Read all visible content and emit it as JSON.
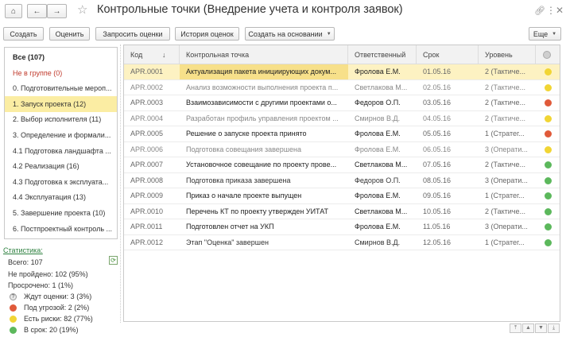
{
  "window": {
    "title": "Контрольные точки (Внедрение учета и контроля заявок)",
    "home_icon": "home-icon",
    "back_icon": "arrow-left-icon",
    "forward_icon": "arrow-right-icon",
    "star_icon": "star-icon",
    "link_icon": "link-icon",
    "menu_icon": "more-vertical-icon",
    "close_icon": "close-icon"
  },
  "toolbar": {
    "create": "Создать",
    "evaluate": "Оценить",
    "request": "Запросить оценки",
    "history": "История оценок",
    "based_on": "Создать на основании",
    "more": "Еще"
  },
  "groups": [
    {
      "label": "Все (107)",
      "style": "bold"
    },
    {
      "label": "Не в группе (0)",
      "style": "red"
    },
    {
      "label": "0. Подготовительные мероп...",
      "style": ""
    },
    {
      "label": "1. Запуск проекта (12)",
      "style": "selected"
    },
    {
      "label": "2. Выбор исполнителя (11)",
      "style": ""
    },
    {
      "label": "3. Определение и формали...",
      "style": ""
    },
    {
      "label": "4.1 Подготовка ландшафта ...",
      "style": ""
    },
    {
      "label": "4.2 Реализация (16)",
      "style": ""
    },
    {
      "label": "4.3 Подготовка к эксплуата...",
      "style": ""
    },
    {
      "label": "4.4 Эксплуатация (13)",
      "style": ""
    },
    {
      "label": "5. Завершение проекта (10)",
      "style": ""
    },
    {
      "label": "6. Постпроектный контроль ...",
      "style": ""
    }
  ],
  "stats": {
    "link": "Статистика:",
    "total": "Всего: 107",
    "not_passed": "Не пройдено: 102 (95%)",
    "overdue": "Просрочено: 1 (1%)",
    "waiting": "Ждут оценки: 3 (3%)",
    "threat": "Под угрозой: 2 (2%)",
    "risks": "Есть риски: 82 (77%)",
    "on_time": "В срок: 20 (19%)",
    "refresh_icon": "refresh-icon"
  },
  "colors": {
    "green": "#5cb85c",
    "yellow": "#f1d534",
    "red": "#e05a3a",
    "grey": "#c8c8c8",
    "selection": "#fbeda3"
  },
  "table": {
    "headers": [
      "Код",
      "Контрольная точка",
      "Ответственный",
      "Срок",
      "Уровень"
    ],
    "status_header_icon": "status-circle-icon",
    "rows": [
      {
        "code": "APR.0001",
        "point": "Актуализация пакета инициирующих докум...",
        "owner": "Фролова Е.М.",
        "date": "01.05.16",
        "level": "2 (Тактиче...",
        "status": "yellow",
        "tone": "strong"
      },
      {
        "code": "APR.0002",
        "point": "Анализ возможности выполнения проекта п...",
        "owner": "Светлакова М...",
        "date": "02.05.16",
        "level": "2 (Тактиче...",
        "status": "yellow",
        "tone": "dim"
      },
      {
        "code": "APR.0003",
        "point": "Взаимозависимости с другими проектами о...",
        "owner": "Федоров О.П.",
        "date": "03.05.16",
        "level": "2 (Тактиче...",
        "status": "red",
        "tone": "strong"
      },
      {
        "code": "APR.0004",
        "point": "Разработан профиль управления проектом ...",
        "owner": "Смирнов В.Д.",
        "date": "04.05.16",
        "level": "2 (Тактиче...",
        "status": "yellow",
        "tone": "dim"
      },
      {
        "code": "APR.0005",
        "point": "Решение о запуске проекта принято",
        "owner": "Фролова Е.М.",
        "date": "05.05.16",
        "level": "1 (Стратег...",
        "status": "red",
        "tone": "strong"
      },
      {
        "code": "APR.0006",
        "point": "Подготовка совещания завершена",
        "owner": "Фролова Е.М.",
        "date": "06.05.16",
        "level": "3 (Операти...",
        "status": "yellow",
        "tone": "dim"
      },
      {
        "code": "APR.0007",
        "point": "Установочное совещание  по проекту прове...",
        "owner": "Светлакова М...",
        "date": "07.05.16",
        "level": "2 (Тактиче...",
        "status": "green",
        "tone": "strong"
      },
      {
        "code": "APR.0008",
        "point": "Подготовка приказа завершена",
        "owner": "Федоров О.П.",
        "date": "08.05.16",
        "level": "3 (Операти...",
        "status": "green",
        "tone": "normal"
      },
      {
        "code": "APR.0009",
        "point": "Приказ о начале проекте выпущен",
        "owner": "Фролова Е.М.",
        "date": "09.05.16",
        "level": "1 (Стратег...",
        "status": "green",
        "tone": "strong"
      },
      {
        "code": "APR.0010",
        "point": "Перечень КТ по проекту утвержден УИТАТ",
        "owner": "Светлакова М...",
        "date": "10.05.16",
        "level": "2 (Тактиче...",
        "status": "green",
        "tone": "strong"
      },
      {
        "code": "APR.0011",
        "point": "Подготовлен отчет на УКП",
        "owner": "Фролова Е.М.",
        "date": "11.05.16",
        "level": "3 (Операти...",
        "status": "green",
        "tone": "strong"
      },
      {
        "code": "APR.0012",
        "point": "Этап \"Оценка\" завершен",
        "owner": "Смирнов В.Д.",
        "date": "12.05.16",
        "level": "1 (Стратег...",
        "status": "green",
        "tone": "normal"
      }
    ]
  },
  "scroll_icons": [
    "scroll-top-icon",
    "scroll-up-icon",
    "scroll-down-icon",
    "scroll-bottom-icon"
  ]
}
